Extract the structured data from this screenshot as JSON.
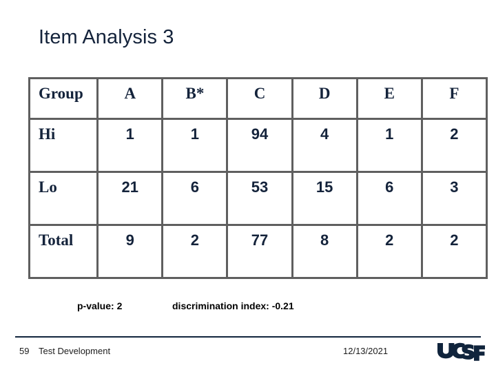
{
  "slide": {
    "title": "Item Analysis 3"
  },
  "table": {
    "headers": [
      "Group",
      "A",
      "B*",
      "C",
      "D",
      "E",
      "F"
    ],
    "rows": [
      {
        "label": "Hi",
        "values": [
          "1",
          "1",
          "94",
          "4",
          "1",
          "2"
        ]
      },
      {
        "label": "Lo",
        "values": [
          "21",
          "6",
          "53",
          "15",
          "6",
          "3"
        ]
      },
      {
        "label": "Total",
        "values": [
          "9",
          "2",
          "77",
          "8",
          "2",
          "2"
        ]
      }
    ]
  },
  "stats": {
    "p_value": "p-value: 2",
    "discrimination_index": "discrimination index: -0.21"
  },
  "footer": {
    "page_number": "59",
    "section": "Test Development",
    "date": "12/13/2021",
    "logo_text": "UCSF"
  },
  "colors": {
    "navy": "#14233b",
    "border_gray": "#5f5f5f",
    "rule": "#10243c"
  },
  "chart_data": {
    "type": "table",
    "title": "Item Analysis 3",
    "categories": [
      "A",
      "B*",
      "C",
      "D",
      "E",
      "F"
    ],
    "series": [
      {
        "name": "Hi",
        "values": [
          1,
          1,
          94,
          4,
          1,
          2
        ]
      },
      {
        "name": "Lo",
        "values": [
          21,
          6,
          53,
          15,
          6,
          3
        ]
      },
      {
        "name": "Total",
        "values": [
          9,
          2,
          77,
          8,
          2,
          2
        ]
      }
    ],
    "row_header": "Group",
    "correct_option": "B*",
    "annotations": [
      "p-value: 2",
      "discrimination index: -0.21"
    ],
    "xlabel": "",
    "ylabel": ""
  }
}
